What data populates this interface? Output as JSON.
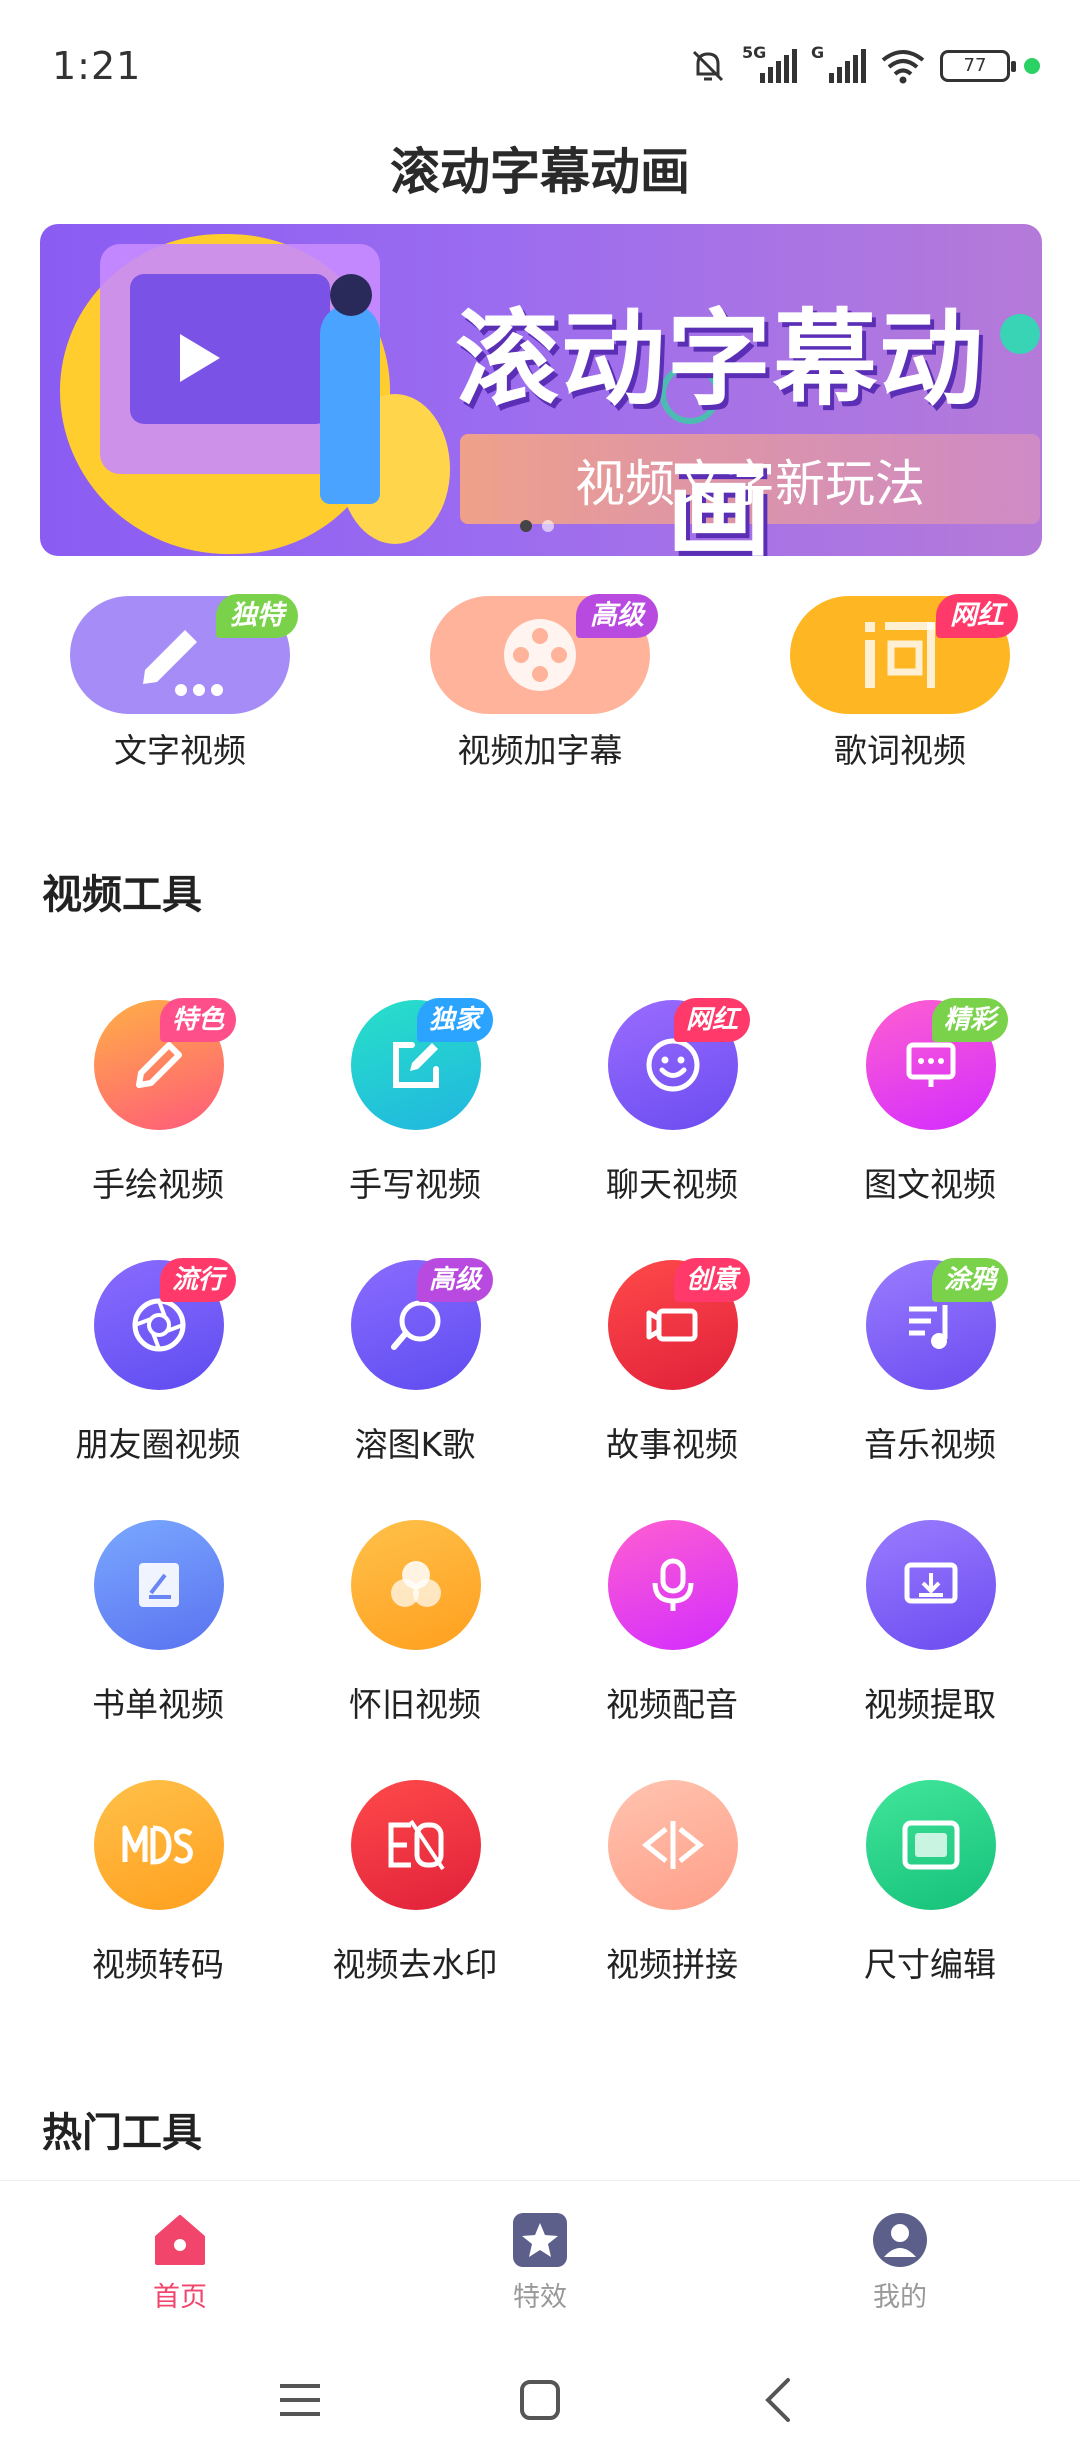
{
  "status": {
    "time": "1:21",
    "network1": "5G",
    "network2": "G",
    "battery": "77"
  },
  "header": {
    "title": "滚动字幕动画"
  },
  "banner": {
    "headline": "滚动字幕动画",
    "subtitle": "视频文字新玩法"
  },
  "features": [
    {
      "label": "文字视频",
      "tag": "独特",
      "tag_color": "#7ad24a",
      "color": "#a68cf6"
    },
    {
      "label": "视频加字幕",
      "tag": "高级",
      "tag_color": "#b84ae0",
      "color": "#ffb39a"
    },
    {
      "label": "歌词视频",
      "tag": "网红",
      "tag_color": "#ff3a6a",
      "color": "#ffb623"
    }
  ],
  "sections": {
    "video_tools": "视频工具",
    "hot_tools": "热门工具"
  },
  "tools": [
    {
      "label": "手绘视频",
      "tag": "特色",
      "tag_color": "#ff4f8a",
      "icon": "pencil-icon",
      "c1": "#ffb046",
      "c2": "#ff5a7a"
    },
    {
      "label": "手写视频",
      "tag": "独家",
      "tag_color": "#2ba4ff",
      "icon": "edit-icon",
      "c1": "#28e0c8",
      "c2": "#20b6e0"
    },
    {
      "label": "聊天视频",
      "tag": "网红",
      "tag_color": "#ff3a6a",
      "icon": "smile-icon",
      "c1": "#9a6cff",
      "c2": "#6b4cf0"
    },
    {
      "label": "图文视频",
      "tag": "精彩",
      "tag_color": "#7ad24a",
      "icon": "slides-icon",
      "c1": "#ff5fd0",
      "c2": "#d32cff"
    },
    {
      "label": "朋友圈视频",
      "tag": "流行",
      "tag_color": "#ff3a6a",
      "icon": "aperture-icon",
      "c1": "#8a6cff",
      "c2": "#5e4cf0"
    },
    {
      "label": "溶图K歌",
      "tag": "高级",
      "tag_color": "#b84ae0",
      "icon": "microphone-ball-icon",
      "c1": "#8a6cff",
      "c2": "#5e4cf0"
    },
    {
      "label": "故事视频",
      "tag": "创意",
      "tag_color": "#ff3a6a",
      "icon": "camera-icon",
      "c1": "#ff4a4a",
      "c2": "#e0203a"
    },
    {
      "label": "音乐视频",
      "tag": "涂鸦",
      "tag_color": "#7ad24a",
      "icon": "music-icon",
      "c1": "#9a7cff",
      "c2": "#6b4cf0"
    },
    {
      "label": "书单视频",
      "tag": "",
      "tag_color": "",
      "icon": "book-icon",
      "c1": "#7aa8ff",
      "c2": "#5a72f0"
    },
    {
      "label": "怀旧视频",
      "tag": "",
      "tag_color": "",
      "icon": "circles-icon",
      "c1": "#ffc14a",
      "c2": "#ff9f1e"
    },
    {
      "label": "视频配音",
      "tag": "",
      "tag_color": "",
      "icon": "mic-icon",
      "c1": "#ff5fd0",
      "c2": "#d32cff"
    },
    {
      "label": "视频提取",
      "tag": "",
      "tag_color": "",
      "icon": "download-screen-icon",
      "c1": "#9a7cff",
      "c2": "#6b4cf0"
    },
    {
      "label": "视频转码",
      "tag": "",
      "tag_color": "",
      "icon": "transcode-icon",
      "c1": "#ffc14a",
      "c2": "#ff9f1e"
    },
    {
      "label": "视频去水印",
      "tag": "",
      "tag_color": "",
      "icon": "no-watermark-icon",
      "c1": "#ff4a4a",
      "c2": "#e0203a"
    },
    {
      "label": "视频拼接",
      "tag": "",
      "tag_color": "",
      "icon": "split-icon",
      "c1": "#ffc4b0",
      "c2": "#ff9e88"
    },
    {
      "label": "尺寸编辑",
      "tag": "",
      "tag_color": "",
      "icon": "frame-icon",
      "c1": "#40e69a",
      "c2": "#16c07a"
    }
  ],
  "tabs": [
    {
      "label": "首页",
      "icon": "home-icon",
      "active": true
    },
    {
      "label": "特效",
      "icon": "star-icon",
      "active": false
    },
    {
      "label": "我的",
      "icon": "user-icon",
      "active": false
    }
  ],
  "colors": {
    "accent": "#f2456c",
    "tab_inactive": "#999999",
    "tab_icon": "#5b5f8a"
  }
}
